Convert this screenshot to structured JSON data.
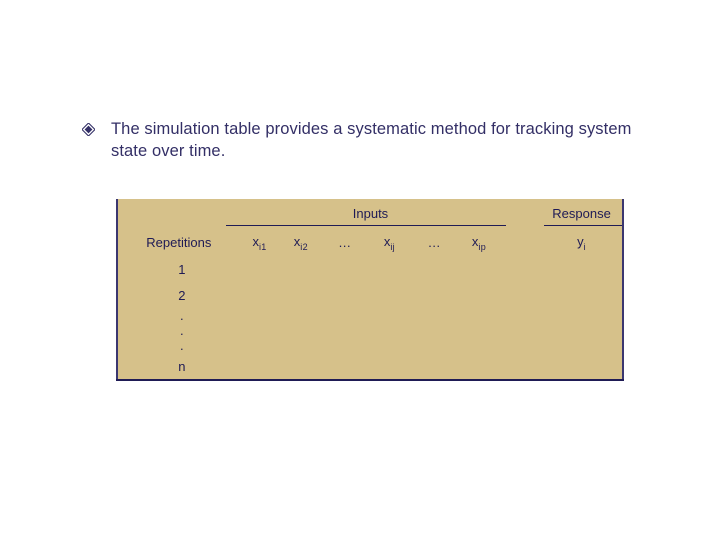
{
  "bullet": {
    "text": "The simulation table provides a systematic method for tracking system state over time."
  },
  "table": {
    "group_inputs": "Inputs",
    "group_response": "Response",
    "col_repetitions": "Repetitions",
    "cols": {
      "x_base": "x",
      "x_i1": "i1",
      "x_i2": "i2",
      "ell": "…",
      "x_ij": "ij",
      "x_ip": "ip",
      "y_base": "y",
      "y_i": "i"
    },
    "rows": {
      "r1": "1",
      "r2": "2",
      "dot": ".",
      "rn": "n"
    }
  },
  "colors": {
    "accent": "#332f66",
    "table_bg": "#d6c18a"
  }
}
